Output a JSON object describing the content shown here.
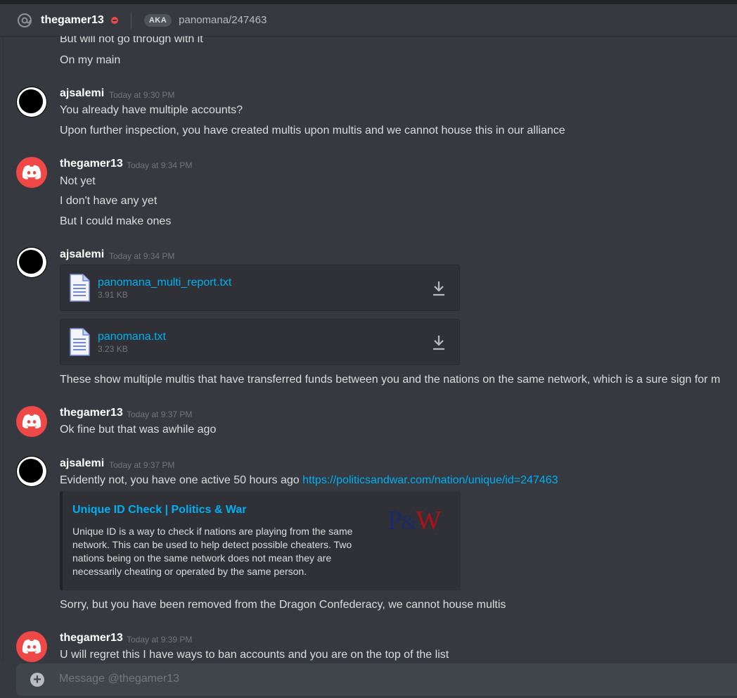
{
  "header": {
    "username": "thegamer13",
    "aka_label": "AKA",
    "aka_names": "panomana/247463"
  },
  "messages": {
    "pre_lines": [
      "But will not go through with it",
      "On my main"
    ],
    "groups": [
      {
        "author": "ajsalemi",
        "timestamp": "Today at 9:30 PM",
        "lines": [
          "You already have multiple accounts?",
          "Upon further inspection, you have created multis upon multis and we cannot house this in our alliance"
        ]
      },
      {
        "author": "thegamer13",
        "timestamp": "Today at 9:34 PM",
        "lines": [
          "Not yet",
          "I don't have any yet",
          "But I could make ones"
        ]
      },
      {
        "author": "ajsalemi",
        "timestamp": "Today at 9:34 PM",
        "attachments": [
          {
            "name": "panomana_multi_report.txt",
            "size": "3.91 KB"
          },
          {
            "name": "panomana.txt",
            "size": "3.23 KB"
          }
        ],
        "lines": [
          "These show multiple multis that have transferred funds between you and the nations on the same network, which is a sure sign for m"
        ]
      },
      {
        "author": "thegamer13",
        "timestamp": "Today at 9:37 PM",
        "lines": [
          "Ok fine but that was awhile ago"
        ]
      },
      {
        "author": "ajsalemi",
        "timestamp": "Today at 9:37 PM",
        "line_prefix": "Evidently not, you have one active 50 hours ago ",
        "link": "https://politicsandwar.com/nation/unique/id=247463",
        "embed": {
          "title": "Unique ID Check | Politics & War",
          "description": "Unique ID is a way to check if nations are playing from the same network. This can be used to help detect possible cheaters. Two nations being on the same network does not mean they are necessarily cheating or operated by the same person.",
          "thumb_p": "P",
          "thumb_amp": "&",
          "thumb_w": "W"
        },
        "lines": [
          "Sorry, but you have been removed from the Dragon Confederacy, we cannot house multis"
        ]
      },
      {
        "author": "thegamer13",
        "timestamp": "Today at 9:39 PM",
        "lines": [
          "U will regret this I have ways to ban accounts and you are on the top of the list"
        ]
      }
    ]
  },
  "input": {
    "placeholder": "Message @thegamer13"
  },
  "colors": {
    "background": "#36393f",
    "link": "#00b0f4",
    "dnd_status": "#f04747",
    "discord_avatar": "#f04747"
  },
  "icons": [
    "at-icon",
    "dnd-status-icon",
    "file-icon",
    "download-icon",
    "discord-logo-icon",
    "add-attachment-icon"
  ]
}
